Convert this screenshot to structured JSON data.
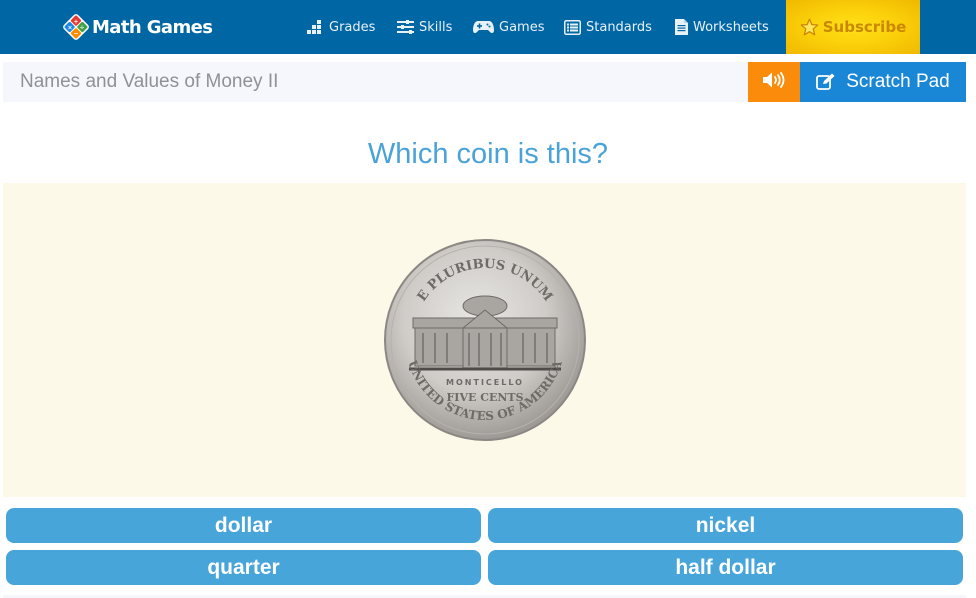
{
  "header": {
    "logo_text": "Math Games",
    "nav": [
      {
        "label": "Grades",
        "icon": "bar-steps-icon"
      },
      {
        "label": "Skills",
        "icon": "sliders-icon"
      },
      {
        "label": "Games",
        "icon": "gamepad-icon"
      },
      {
        "label": "Standards",
        "icon": "list-icon"
      },
      {
        "label": "Worksheets",
        "icon": "document-icon"
      }
    ],
    "subscribe_label": "Subscribe",
    "subscribe_icon": "star-icon"
  },
  "toolbar": {
    "activity_title": "Names and Values of Money II",
    "sound_icon": "volume-icon",
    "scratch_pad_label": "Scratch Pad",
    "scratch_pad_icon": "edit-icon"
  },
  "question": {
    "prompt": "Which coin is this?",
    "coin": {
      "name": "nickel-reverse",
      "top_inscription": "E PLURIBUS UNUM",
      "building_label": "MONTICELLO",
      "value_text": "FIVE CENTS",
      "bottom_inscription": "UNITED STATES OF AMERICA"
    }
  },
  "answers": [
    {
      "label": "dollar"
    },
    {
      "label": "nickel"
    },
    {
      "label": "quarter"
    },
    {
      "label": "half dollar"
    }
  ],
  "colors": {
    "nav_bg": "#0066a4",
    "subscribe_bg": "#fbd10a",
    "sound_bg": "#fa8b0b",
    "scratch_bg": "#1a87d6",
    "question_text": "#4aa3d8",
    "answer_bg": "#48a5da",
    "coin_area_bg": "#fdf9e8"
  }
}
